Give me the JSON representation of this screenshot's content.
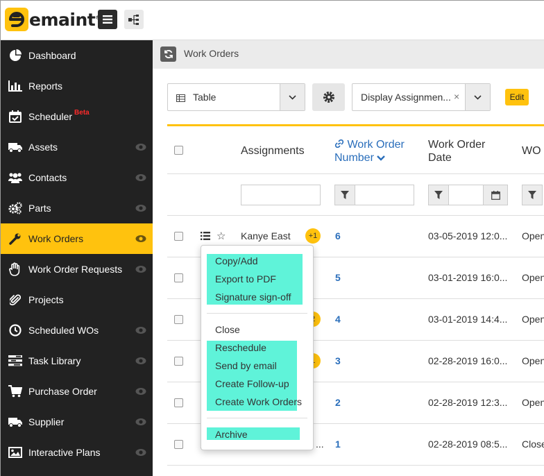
{
  "app": {
    "logo_text": "emaint",
    "logo_mark": "®"
  },
  "sidebar": {
    "items": [
      {
        "label": "Dashboard",
        "icon": "pie-chart-icon",
        "has_eye": false,
        "active": false
      },
      {
        "label": "Reports",
        "icon": "bar-chart-icon",
        "has_eye": false,
        "active": false
      },
      {
        "label": "Scheduler",
        "badge": "Beta",
        "icon": "calendar-check-icon",
        "has_eye": false,
        "active": false
      },
      {
        "label": "Assets",
        "icon": "truck-icon",
        "has_eye": true,
        "active": false
      },
      {
        "label": "Contacts",
        "icon": "users-icon",
        "has_eye": true,
        "active": false
      },
      {
        "label": "Parts",
        "icon": "cogs-icon",
        "has_eye": true,
        "active": false
      },
      {
        "label": "Work Orders",
        "icon": "wrench-icon",
        "has_eye": true,
        "active": true
      },
      {
        "label": "Work Order Requests",
        "icon": "hand-icon",
        "has_eye": true,
        "active": false
      },
      {
        "label": "Projects",
        "icon": "paperclip-icon",
        "has_eye": false,
        "active": false
      },
      {
        "label": "Scheduled WOs",
        "icon": "clock-icon",
        "has_eye": true,
        "active": false
      },
      {
        "label": "Task Library",
        "icon": "tasks-icon",
        "has_eye": true,
        "active": false
      },
      {
        "label": "Purchase Order",
        "icon": "cart-icon",
        "has_eye": true,
        "active": false
      },
      {
        "label": "Supplier",
        "icon": "truck-icon",
        "has_eye": true,
        "active": false
      },
      {
        "label": "Interactive Plans",
        "icon": "image-icon",
        "has_eye": true,
        "active": false
      }
    ]
  },
  "page": {
    "title": "Work Orders"
  },
  "toolbar": {
    "view_label": "Table",
    "assignments_label": "Display Assignmen...",
    "assignments_clear": "×",
    "edit_label": "Edit"
  },
  "table": {
    "headers": {
      "assignments": "Assignments",
      "wo_number_line1": "Work Order",
      "wo_number_line2": "Number",
      "wo_date_line1": "Work Order",
      "wo_date_line2": "Date",
      "wo_status": "WO S"
    },
    "rows": [
      {
        "assignee": "Kanye East",
        "count": "+1",
        "number": "6",
        "date": "03-05-2019 12:0...",
        "status": "Open"
      },
      {
        "assignee": "",
        "count": "",
        "number": "5",
        "date": "03-01-2019 16:0...",
        "status": "Open"
      },
      {
        "assignee": "",
        "count": "2",
        "number": "4",
        "date": "03-01-2019 14:4...",
        "status": "Open"
      },
      {
        "assignee": "",
        "count": "1",
        "number": "3",
        "date": "02-28-2019 16:0...",
        "status": "Open"
      },
      {
        "assignee": "",
        "count": "",
        "number": "2",
        "date": "02-28-2019 12:3...",
        "status": "Open"
      },
      {
        "assignee": "...",
        "count": "",
        "number": "1",
        "date": "02-28-2019 08:5...",
        "status": "Close"
      }
    ]
  },
  "context_menu": {
    "group1": [
      "Copy/Add",
      "Export to PDF",
      "Signature sign-off"
    ],
    "group2": [
      "Close",
      "Reschedule",
      "Send by email",
      "Create Follow-up",
      "Create Work Orders"
    ],
    "group3": [
      "Archive"
    ],
    "highlight_color": "#5ff3d9"
  },
  "colors": {
    "accent": "#ffc20e",
    "sidebar_bg": "#222222",
    "link": "#2a6ebb"
  }
}
